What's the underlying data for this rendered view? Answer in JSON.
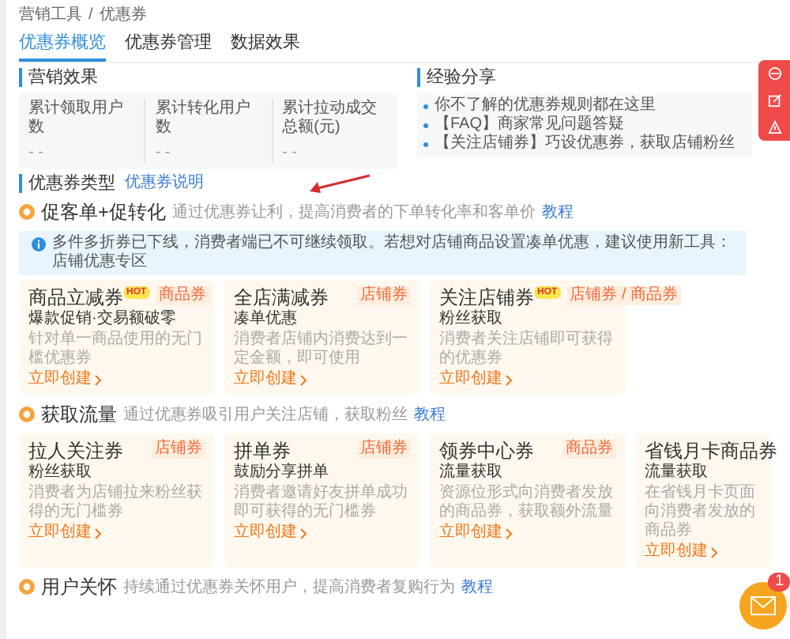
{
  "breadcrumb": [
    "营销工具",
    "/",
    "优惠券"
  ],
  "tabs": [
    {
      "label": "优惠券概览",
      "selected": true
    },
    {
      "label": "优惠券管理",
      "selected": false
    },
    {
      "label": "数据效果",
      "selected": false
    }
  ],
  "marketing_effect": {
    "title": "营销效果",
    "stats": [
      {
        "label": "累计领取用户数",
        "value": "- -"
      },
      {
        "label": "累计转化用户数",
        "value": "- -"
      },
      {
        "label": "累计拉动成交总额(元)",
        "value": "- -"
      }
    ]
  },
  "experience": {
    "title": "经验分享",
    "items": [
      "你不了解的优惠券规则都在这里",
      "【FAQ】商家常见问题答疑",
      "【关注店铺券】巧设优惠券，获取店铺粉丝"
    ]
  },
  "coupon_types": {
    "title": "优惠券类型",
    "link": "优惠券说明"
  },
  "groups": [
    {
      "title": "促客单+促转化",
      "desc": "通过优惠券让利，提高消费者的下单转化率和客单价",
      "link": "教程",
      "notice": "多件多折券已下线，消费者端已不可继续领取。若想对店铺商品设置凑单优惠，建议使用新工具：店铺优惠专区",
      "cards": [
        {
          "title": "商品立减券",
          "hot": "HOT",
          "tag": "商品券",
          "subtitle": "爆款促销·交易额破零",
          "desc": "针对单一商品使用的无门槛优惠券",
          "action": "立即创建"
        },
        {
          "title": "全店满减券",
          "tag": "店铺券",
          "subtitle": "凑单优惠",
          "desc": "消费者店铺内消费达到一定金额，即可使用",
          "action": "立即创建"
        },
        {
          "title": "关注店铺券",
          "hot": "HOT",
          "tag": "店铺券 / 商品券",
          "subtitle": "粉丝获取",
          "desc": "消费者关注店铺即可获得的优惠券",
          "action": "立即创建"
        }
      ]
    },
    {
      "title": "获取流量",
      "desc": "通过优惠券吸引用户关注店铺，获取粉丝",
      "link": "教程",
      "cards": [
        {
          "title": "拉人关注券",
          "tag": "店铺券",
          "subtitle": "粉丝获取",
          "desc": "消费者为店铺拉来粉丝获得的无门槛券",
          "action": "立即创建"
        },
        {
          "title": "拼单券",
          "tag": "店铺券",
          "subtitle": "鼓励分享拼单",
          "desc": "消费者邀请好友拼单成功即可获得的无门槛券",
          "action": "立即创建"
        },
        {
          "title": "领券中心券",
          "tag": "商品券",
          "subtitle": "流量获取",
          "desc": "资源位形式向消费者发放的商品券，获取额外流量",
          "action": "立即创建"
        },
        {
          "title": "省钱月卡商品券",
          "subtitle": "流量获取",
          "desc": "在省钱月卡页面向消费者发放的商品券",
          "action": "立即创建"
        }
      ]
    },
    {
      "title": "用户关怀",
      "desc": "持续通过优惠券关怀用户，提高消费者复购行为",
      "link": "教程"
    }
  ],
  "mail": {
    "badge": "1"
  }
}
